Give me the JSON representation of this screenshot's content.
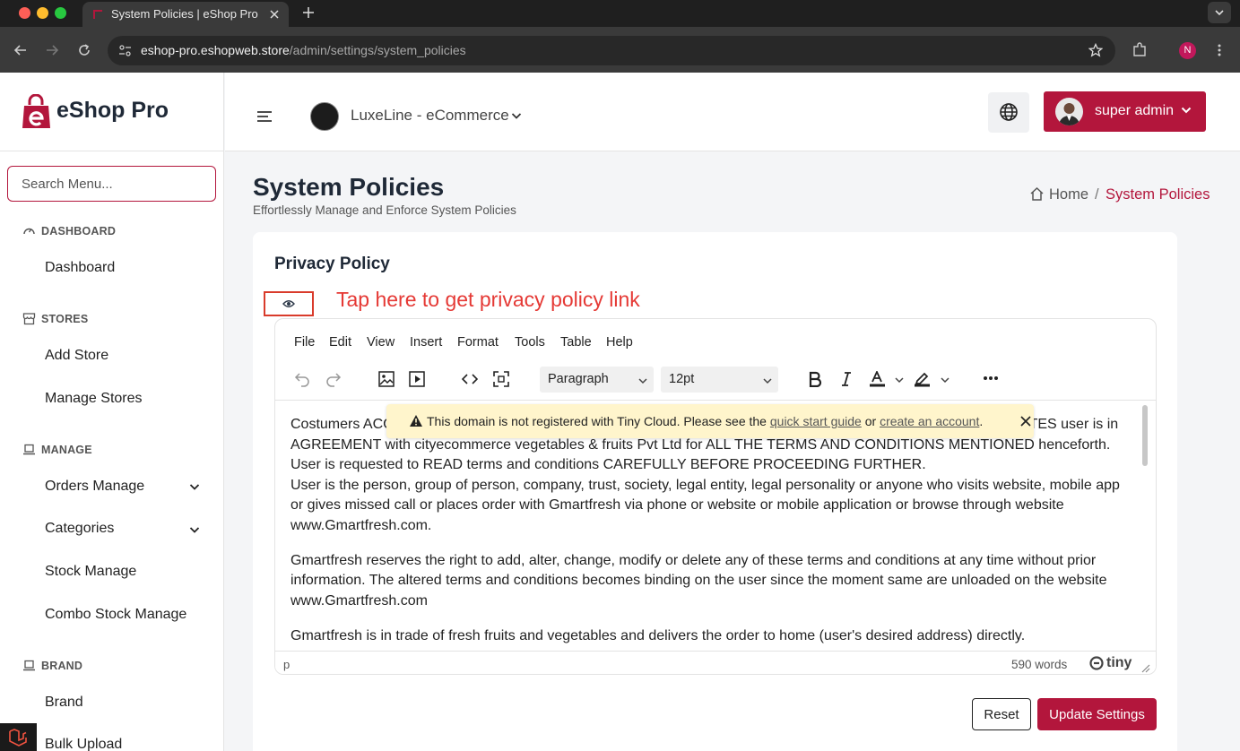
{
  "browser": {
    "tab_title": "System Policies | eShop Pro",
    "url_host": "eshop-pro.eshopweb.store",
    "url_path": "/admin/settings/system_policies",
    "profile_initial": "N"
  },
  "sidebar": {
    "brand": "eShop Pro",
    "search_placeholder": "Search Menu...",
    "sections": {
      "dashboard": "DASHBOARD",
      "stores": "STORES",
      "manage": "MANAGE",
      "brand": "BRAND"
    },
    "items": {
      "dashboard": "Dashboard",
      "add_store": "Add Store",
      "manage_stores": "Manage Stores",
      "orders_manage": "Orders Manage",
      "categories": "Categories",
      "stock_manage": "Stock Manage",
      "combo_stock_manage": "Combo Stock Manage",
      "brand": "Brand",
      "bulk_upload": "Bulk Upload"
    }
  },
  "header": {
    "store_name": "LuxeLine - eCommerce",
    "user_name": "super admin"
  },
  "page": {
    "title": "System Policies",
    "subtitle": "Effortlessly Manage and Enforce System Policies",
    "breadcrumb_home": "Home",
    "breadcrumb_sep": "/",
    "breadcrumb_current": "System Policies"
  },
  "card": {
    "title": "Privacy Policy",
    "annotation": "Tap here to get privacy policy link"
  },
  "editor": {
    "menus": [
      "File",
      "Edit",
      "View",
      "Insert",
      "Format",
      "Tools",
      "Table",
      "Help"
    ],
    "block_format": "Paragraph",
    "font_size": "12pt",
    "notice_prefix": "This domain is not registered with Tiny Cloud. Please see the",
    "notice_link1": "quick start guide",
    "notice_mid": "or",
    "notice_link2": "create an account",
    "notice_suffix": ".",
    "paragraphs": [
      "Costumers ACCESSING, BROWSING OR OTHERWISE USING www.Gmartfresh.com or mobile application INDICATES user is in AGREEMENT with cityecommerce vegetables & fruits Pvt Ltd for ALL THE TERMS AND CONDITIONS MENTIONED henceforth. User is requested to READ terms and conditions CAREFULLY BEFORE PROCEEDING FURTHER.",
      "User is the person, group of person, company, trust, society, legal entity, legal personality or anyone who visits website, mobile app or gives missed call or places order with Gmartfresh via phone or website or mobile application or browse through website www.Gmartfresh.com.",
      "Gmartfresh reserves the right to add, alter, change, modify or delete any of these terms and conditions at any time without prior information. The altered terms and conditions becomes binding on the user since the moment same are unloaded on the website www.Gmartfresh.com",
      "Gmartfresh is in trade of fresh fruits and vegetables and delivers the order to home (user's desired address) directly."
    ],
    "status_path": "p",
    "word_count": "590 words",
    "brand": "tiny"
  },
  "buttons": {
    "reset": "Reset",
    "update": "Update Settings"
  },
  "colors": {
    "accent": "#b3163c",
    "annotation": "#e53935",
    "notice_bg": "#fff5cc"
  }
}
